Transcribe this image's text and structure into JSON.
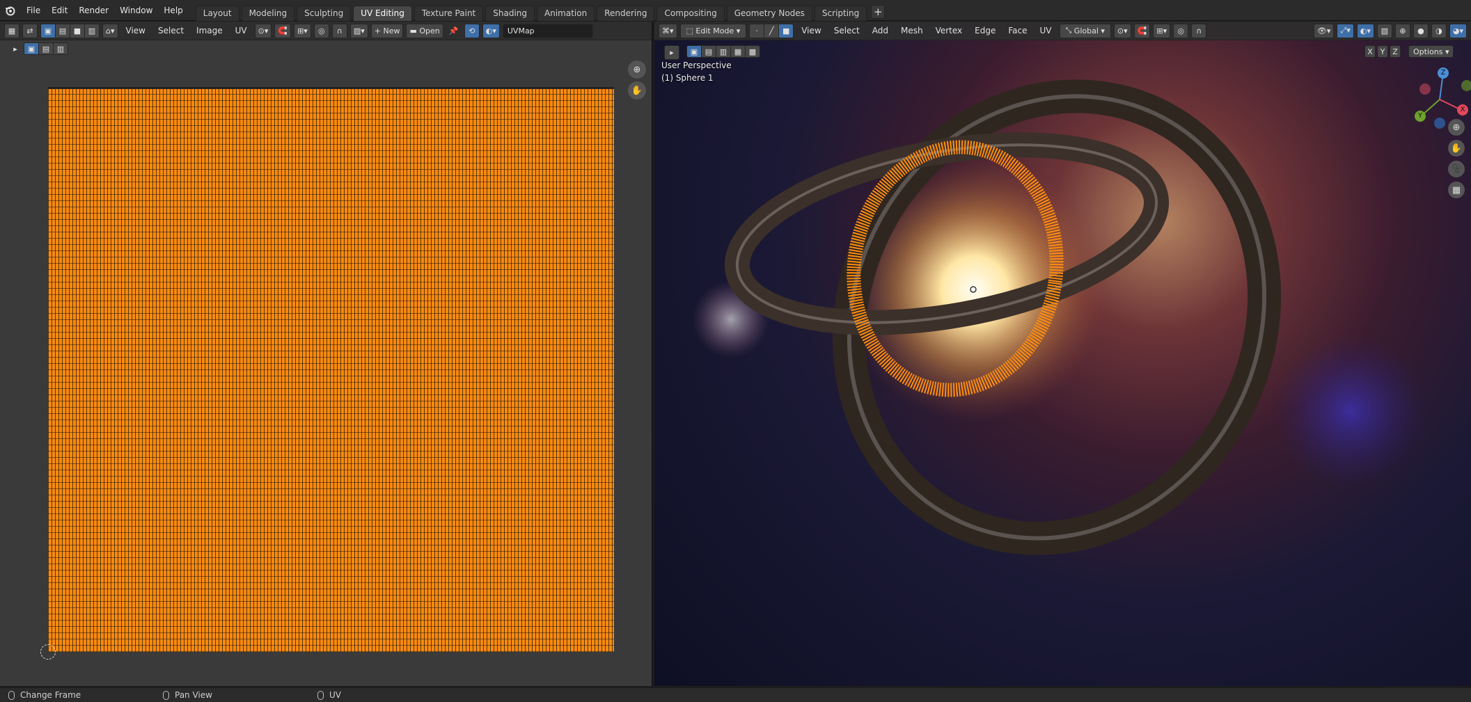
{
  "menu": [
    "File",
    "Edit",
    "Render",
    "Window",
    "Help"
  ],
  "workspaces": [
    "Layout",
    "Modeling",
    "Sculpting",
    "UV Editing",
    "Texture Paint",
    "Shading",
    "Animation",
    "Rendering",
    "Compositing",
    "Geometry Nodes",
    "Scripting"
  ],
  "active_workspace": "UV Editing",
  "uv_editor": {
    "menu": [
      "View",
      "Select",
      "Image",
      "UV"
    ],
    "new_label": "New",
    "open_label": "Open",
    "uvmap": "UVMap",
    "island_color": "#ff8a0c"
  },
  "viewport": {
    "mode": "Edit Mode",
    "menu": [
      "View",
      "Select",
      "Add",
      "Mesh",
      "Vertex",
      "Edge",
      "Face",
      "UV"
    ],
    "orientation": "Global",
    "axes": [
      "X",
      "Y",
      "Z"
    ],
    "options_label": "Options",
    "perspective": "User Perspective",
    "object": "(1) Sphere 1"
  },
  "gizmo": {
    "x": "X",
    "y": "Y",
    "z": "Z"
  },
  "status": [
    "Change Frame",
    "Pan View",
    "UV"
  ]
}
